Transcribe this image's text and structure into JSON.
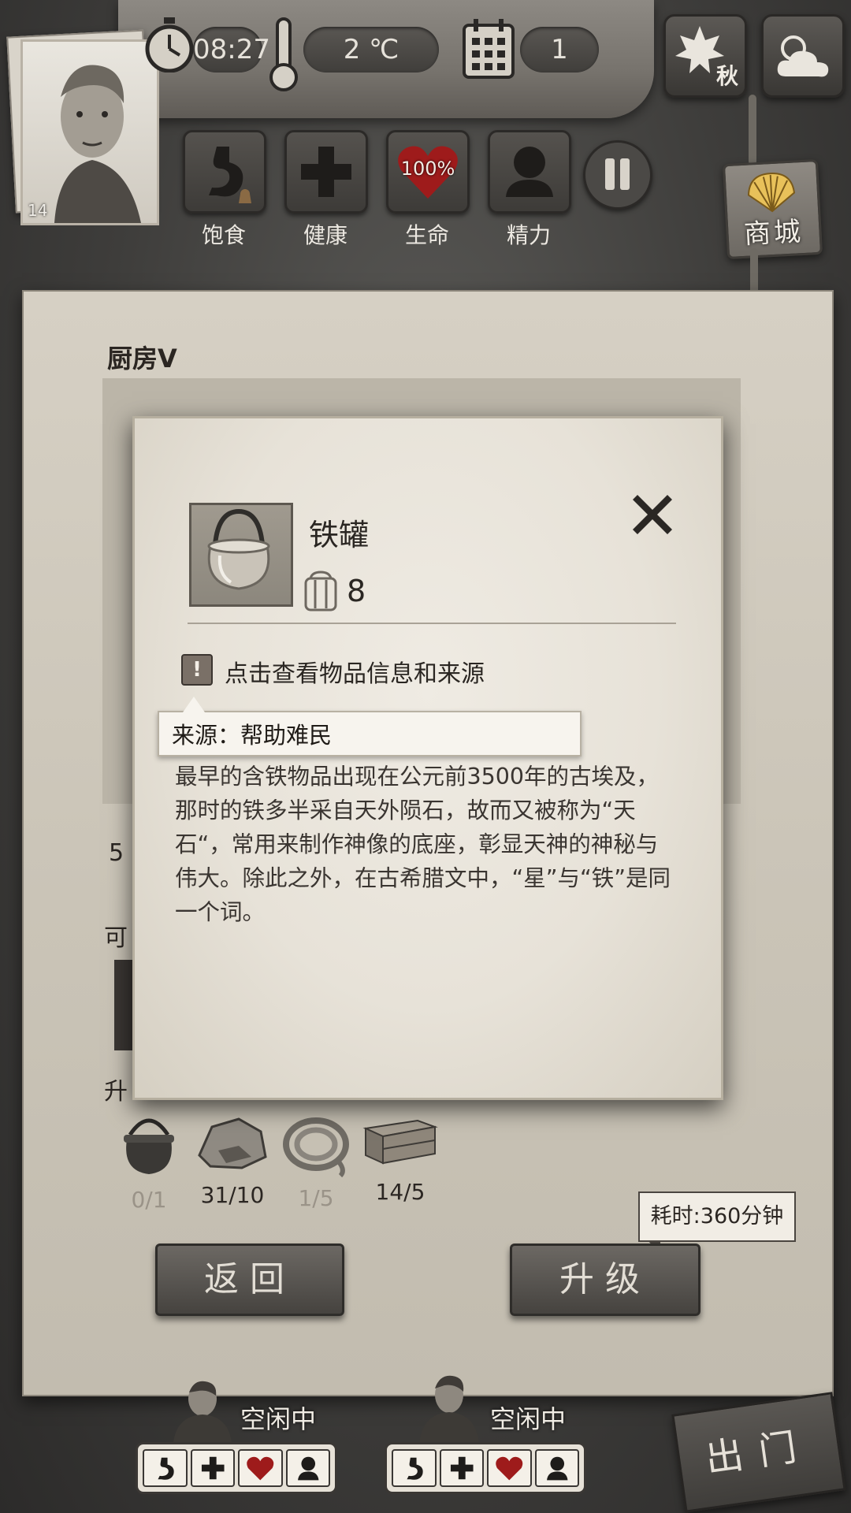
{
  "hud": {
    "time": "08:27",
    "temperature": "2 ℃",
    "day": "1",
    "season": "秋",
    "level": "14"
  },
  "stats": [
    {
      "label": "饱食",
      "icon": "stomach-icon"
    },
    {
      "label": "健康",
      "icon": "health-cross-icon"
    },
    {
      "label": "生命",
      "icon": "heart-icon",
      "value": "100%"
    },
    {
      "label": "精力",
      "icon": "energy-person-icon"
    }
  ],
  "shop": {
    "label": "商城"
  },
  "panel": {
    "title": "厨房Ⅴ",
    "partial_a": "5",
    "partial_b": "可",
    "partial_c": "升",
    "materials": [
      {
        "icon": "iron-pot-icon",
        "count": "0/1",
        "sufficient": false
      },
      {
        "icon": "stone-icon",
        "count": "31/10",
        "sufficient": true
      },
      {
        "icon": "rope-icon",
        "count": "1/5",
        "sufficient": false
      },
      {
        "icon": "wood-planks-icon",
        "count": "14/5",
        "sufficient": true
      }
    ],
    "time_cost": "耗时:360分钟",
    "back_label": "返回",
    "upgrade_label": "升级"
  },
  "characters": [
    {
      "status": "空闲中"
    },
    {
      "status": "空闲中"
    }
  ],
  "exit_label": "出门",
  "dialog": {
    "item_name": "铁罐",
    "item_quantity": "8",
    "info_hint": "点击查看物品信息和来源",
    "source": "来源：帮助难民",
    "description": "最早的含铁物品出现在公元前3500年的古埃及，那时的铁多半采自天外陨石，故而又被称为“天石“，常用来制作神像的底座，彰显天神的神秘与伟大。除此之外，在古希腊文中，“星”与“铁”是同一个词。"
  },
  "colors": {
    "parchment": "#e7e2d8",
    "wood": "#55524e",
    "text_dark": "#2a2622",
    "heart_red": "#9e1b1b"
  }
}
